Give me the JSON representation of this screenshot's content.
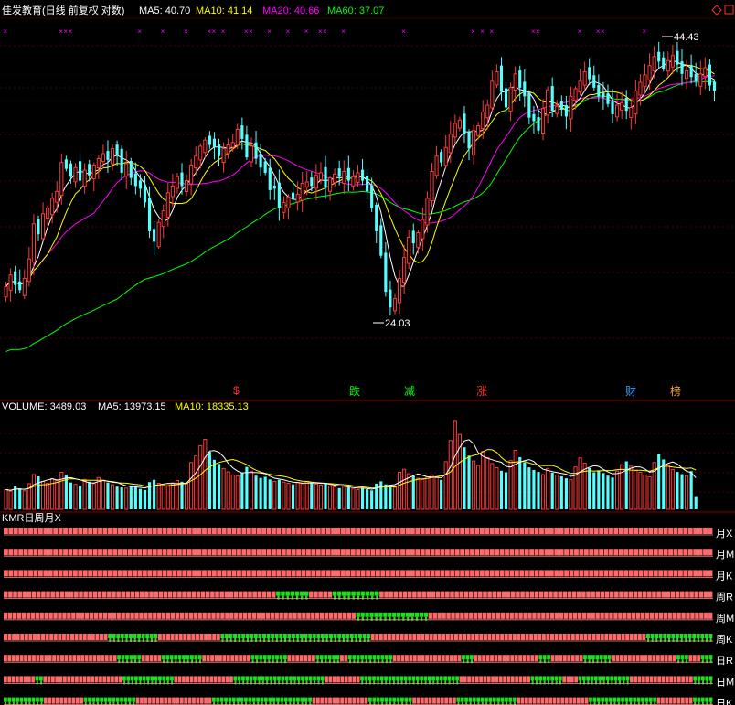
{
  "header": {
    "title": "佳发教育(日线 前复权 对数)",
    "ma": [
      {
        "label": "MA5: 40.70",
        "color": "#ffffff"
      },
      {
        "label": "MA10: 41.14",
        "color": "#ffff00"
      },
      {
        "label": "MA20: 40.66",
        "color": "#ff00ff"
      },
      {
        "label": "MA60: 37.07",
        "color": "#00ff00"
      }
    ]
  },
  "annotations": {
    "high": "44.43",
    "low": "24.03"
  },
  "event_markers": [
    {
      "text": "$",
      "color": "#ff3030"
    },
    {
      "text": "跌",
      "color": "#00ff00"
    },
    {
      "text": "减",
      "color": "#00ff00"
    },
    {
      "text": "涨",
      "color": "#ff3030"
    },
    {
      "text": "财",
      "color": "#40a0ff"
    },
    {
      "text": "榜",
      "color": "#ffa040"
    }
  ],
  "volume_header": {
    "title": "VOLUME: 3489.03",
    "ma5": "MA5: 13973.15",
    "ma10": "MA10: 18335.13"
  },
  "kmr": {
    "title": "KMR日周月X",
    "rows": [
      {
        "label": "月X",
        "pattern": "RRRRRRRRRRRRRRRRRRRRRRRRRRRRRRRRRRRRRRRRRRRRRRRRRRRRRRRRRRRRRRRRRRRRRRRRRRRRRRRRRRRRRRRRRRRRRRRRRRRRRRRRRRRRRRRRRRRRRRRRRRRRRRRRRRRRRRRRRRRRRRR"
      },
      {
        "label": "月M",
        "pattern": "RRRRRRRRRRRRRRRRRRRRRRRRRRRRRRRRRRRRRRRRRRRRRRRRRRRRRRRRRRRRRRRRRRRRRRRRRRRRRRRRRRRRRRRRRRRRRRRRRRRRRRRRRRRRRRRRRRRRRRRRRRRRRRRRRRRRRRRRRRRRRRR"
      },
      {
        "label": "月K",
        "pattern": "RRRRRRRRRRRRRRRRRRRRRRRRRRRRRRRRRRRRRRRRRRRRRRRRRRRRRRRRRRRRRRRRRRRRRRRRRRRRRRRRRRRRRRRRRRRRRRRRRRRRRRRRRRRRRRRRRRRRRRRRRRRRRRRRRRRRRRRRRRRRRRR"
      },
      {
        "label": "周R",
        "pattern": "RRRRRRRRRRRRRRRRRRRRRRRRRRRRRRRRRRRRRRRRRRRRRRRRRRRRRRRRRRGGGGGGGRRRRRGGGGGGGGGGRRRRRRRRRRRRRRRRRRRRRRRRRRRRRRRRRRRRRRRRRRRRRRRRRRRRRRRRRRRRRRRRRRRRRRR"
      },
      {
        "label": "周M",
        "pattern": "RRRRRRRRRRRRRRRRRRRRRRRRRRRRRRRRRRRRRRRRRRRRRRRRRRRRRRRRRRRRRRRRRRRRRRRRRRRRRRGGGGGGGGGGGGGGGGRRRRRRRRRRRRRRRRRRRRRRRRRRRRRRRRRRRRRRRRRRRRRRRRRRRRRRRRRRRRRRR"
      },
      {
        "label": "周K",
        "pattern": "RRRRRRRRRRRRRRRRRRRRRRRRRGGGGGGGGGGGGRRRRRRRRRRRRRRRGGGGGGGGGGGGGGGGGGGGGGGGGGGGGGGGGGGGRRRRRRRRRRRRRRRRRRRRRRRRRRRRRRRRRRRRRRRRRRRRRRRRRRRRRRRRRRRRRRRRRRGGGGGGGGGGGGGGGG"
      },
      {
        "label": "日R",
        "pattern": "RRRRRRRRRRRRRRRRRRRRRRRRRRRRGGGGGGRRRRRGGGGGGGGGGRRRRRRRRRRRRGGGGGGGGGRRRRRRRGGGGGGRRGGGGGGGGGGGRRRRRRRRRRRRRRRRRGGGRRRRRRRRRRRRRRRRGGGRRRRRRRRGGGGGGGRRRRRRRRRRRRRRRRGGGRRRGGG"
      },
      {
        "label": "日M",
        "pattern": "RRRRRRRRGGRRRRRRRRRRRRRRRRRRRRGGGGGGGGGGGGGRRRRRRRRRRRRRRRGGGGGGGGGGGGGGGGGGGGGGGRRRRRRRRRGGGGGGGGGGGGGGGGGGGGGGGGGRRRRRRRRRRRRRRRRRRGGGGGGGGRRRRGGGGGGGGGGGGGRRRRRRRRRRRRRRRRGGGGG"
      },
      {
        "label": "日K",
        "pattern": "GGGGGGGGGGRRRRRRRRRRGGGGGGGGGGGGGRRRRRRRRRRRRRRRRRRRGGGGGGGGGGGGGGGGGGGGGGGGGRRRRRRRRRRRRRRGGGGGGGGGGGRRRRRRRRRRRGGGGGGGGGGGGGGGRRRRRRRRRRRRRRRRRRGGGGGGGGGGGGGGGGGRRRRRRRRRGGGGG"
      }
    ]
  },
  "chart_data": {
    "type": "candlestick",
    "title": "佳发教育(日线 前复权 对数)",
    "scale": "log",
    "ylim": [
      20.5,
      47.0
    ],
    "colors": {
      "up": "#ff3a3a",
      "down": "#54ffff",
      "ma5": "#ffffff",
      "ma10": "#ffff00",
      "ma20": "#ff00ff",
      "ma60": "#00ff00"
    },
    "close": [
      26.1,
      26.8,
      26.2,
      25.9,
      26.6,
      27.8,
      30.1,
      29.4,
      30.8,
      31.2,
      31.9,
      32.4,
      34.6,
      34.1,
      33.5,
      34.2,
      33.2,
      34.0,
      33.6,
      34.4,
      34.9,
      35.3,
      34.8,
      35.7,
      35.2,
      33.8,
      34.5,
      33.4,
      32.8,
      32.6,
      31.6,
      29.6,
      28.9,
      30.2,
      31.0,
      32.3,
      32.8,
      33.5,
      32.8,
      33.2,
      34.4,
      35.1,
      35.9,
      36.4,
      36.0,
      35.8,
      35.1,
      35.7,
      36.0,
      36.2,
      37.3,
      36.5,
      35.0,
      35.9,
      34.9,
      34.2,
      33.8,
      32.5,
      32.6,
      31.2,
      31.6,
      32.0,
      31.8,
      32.2,
      33.0,
      33.1,
      32.8,
      33.6,
      33.8,
      32.7,
      33.4,
      33.7,
      33.5,
      33.9,
      33.2,
      33.5,
      33.8,
      33.2,
      32.4,
      31.2,
      29.6,
      28.0,
      25.8,
      24.9,
      25.4,
      26.6,
      27.9,
      29.2,
      28.8,
      29.5,
      30.4,
      31.9,
      33.9,
      35.1,
      34.6,
      35.8,
      36.9,
      37.8,
      38.1,
      36.9,
      35.7,
      37.2,
      37.6,
      38.8,
      39.4,
      41.6,
      42.5,
      40.6,
      39.2,
      41.0,
      42.3,
      41.0,
      40.2,
      38.3,
      38.0,
      37.2,
      39.1,
      40.8,
      38.9,
      39.3,
      39.0,
      38.4,
      40.2,
      40.9,
      41.6,
      42.5,
      41.8,
      41.0,
      40.2,
      40.1,
      39.5,
      38.6,
      39.4,
      39.6,
      38.9,
      39.2,
      40.7,
      41.5,
      42.2,
      43.1,
      44.0,
      43.5,
      42.8,
      43.6,
      44.1,
      43.2,
      42.3,
      42.6,
      42.0,
      41.6,
      42.3,
      42.9,
      41.2,
      40.7
    ],
    "volume": [
      5200,
      4800,
      6100,
      5500,
      4900,
      6800,
      9200,
      8700,
      7400,
      6900,
      8100,
      7600,
      9800,
      9200,
      7100,
      6600,
      6200,
      7900,
      7300,
      6800,
      8400,
      7700,
      7100,
      6500,
      6000,
      5800,
      5600,
      6300,
      5900,
      5400,
      5100,
      7200,
      7800,
      6900,
      6400,
      6100,
      7000,
      7600,
      7300,
      6800,
      12400,
      14100,
      16800,
      18500,
      15200,
      13100,
      12000,
      10800,
      9900,
      9100,
      8800,
      9600,
      11200,
      10100,
      8900,
      8300,
      8600,
      7900,
      7400,
      7800,
      7200,
      6900,
      6600,
      7100,
      6800,
      7400,
      7000,
      6700,
      6400,
      6900,
      6200,
      5900,
      5600,
      6100,
      5800,
      5400,
      5200,
      5700,
      5300,
      5000,
      6800,
      7400,
      6600,
      6100,
      5800,
      9800,
      10600,
      9400,
      8800,
      8200,
      7900,
      8600,
      9100,
      8400,
      7800,
      12600,
      18200,
      23500,
      19800,
      16400,
      14200,
      12800,
      11600,
      15300,
      13700,
      12100,
      11000,
      10200,
      9800,
      12900,
      15600,
      13800,
      12400,
      11100,
      10400,
      9900,
      9200,
      10800,
      9700,
      9100,
      8700,
      8200,
      7800,
      11200,
      13600,
      12200,
      10900,
      9800,
      10300,
      9600,
      8900,
      8400,
      10100,
      11800,
      12700,
      11400,
      10300,
      9800,
      9100,
      8600,
      12400,
      14700,
      13200,
      11800,
      10500,
      9900,
      9300,
      8800,
      10100,
      3489
    ]
  }
}
